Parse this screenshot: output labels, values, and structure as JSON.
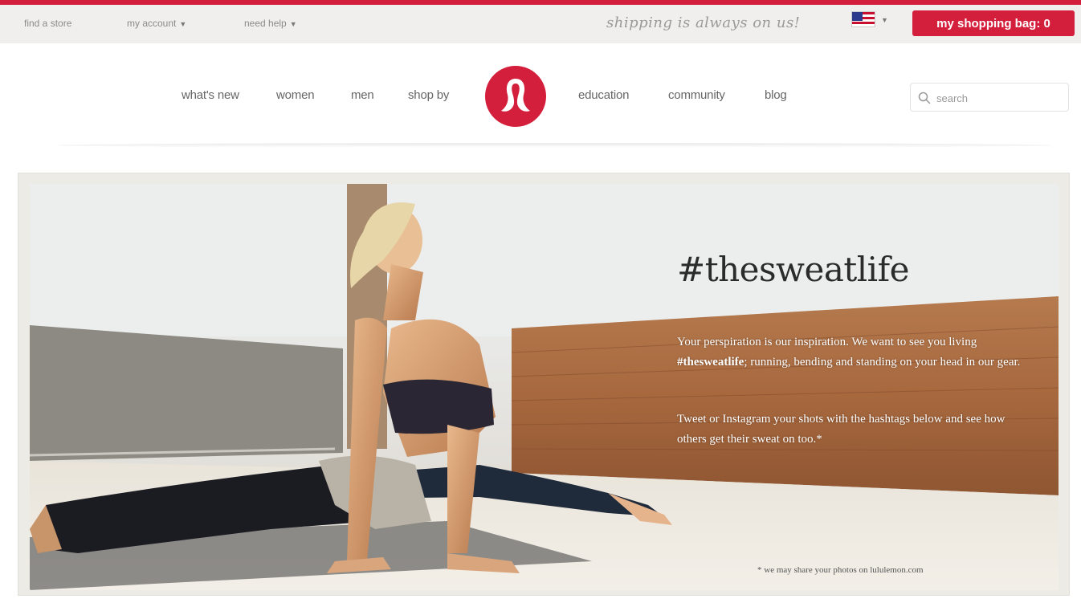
{
  "utility_bar": {
    "find_store": "find a store",
    "my_account": "my account",
    "need_help": "need help",
    "shipping_text": "shipping is always on us!",
    "shopping_bag_label": "my shopping bag: 0",
    "flag": "us-flag-icon"
  },
  "nav": {
    "items_left": [
      "what's new",
      "women",
      "men",
      "shop by"
    ],
    "items_right": [
      "education",
      "community",
      "blog"
    ],
    "search_placeholder": "search",
    "logo": "lululemon-logo"
  },
  "hero": {
    "hashtag": "#thesweatlife",
    "para1_before": "Your perspiration is our inspiration. We want to see  you living ",
    "para1_bold": "#thesweatlife",
    "para1_after": "; running, bending and standing on your head in our gear.",
    "para2": "Tweet or Instagram your shots with the hashtags below and see how others get their sweat on too.*",
    "footnote": "* we may share your photos on lululemon.com"
  },
  "colors": {
    "brand_red": "#d41f3c",
    "utility_bg": "#f1efee",
    "hero_text": "#2b2b2b"
  }
}
